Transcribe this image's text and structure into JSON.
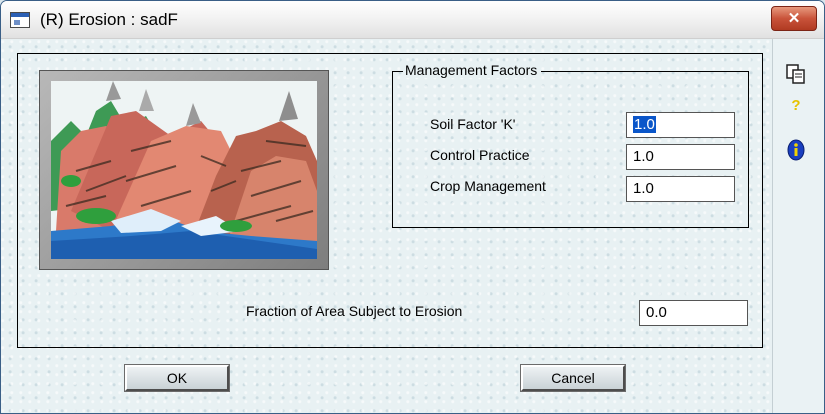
{
  "window": {
    "title": "(R) Erosion : sadF",
    "close_symbol": "✕"
  },
  "image_icon": "mountain-erosion-illustration",
  "management": {
    "group_label": "Management Factors",
    "fields": [
      {
        "label": "Soil Factor 'K'",
        "value": "1.0"
      },
      {
        "label": "Control Practice",
        "value": "1.0"
      },
      {
        "label": "Crop Management",
        "value": "1.0"
      }
    ]
  },
  "fraction": {
    "label": "Fraction of Area Subject to Erosion",
    "value": "0.0"
  },
  "buttons": {
    "ok": "OK",
    "cancel": "Cancel"
  },
  "sidebar": {
    "icons": [
      "copy-icon",
      "help-icon",
      "info-icon"
    ],
    "help_glyph": "?",
    "info_glyph": "i"
  }
}
